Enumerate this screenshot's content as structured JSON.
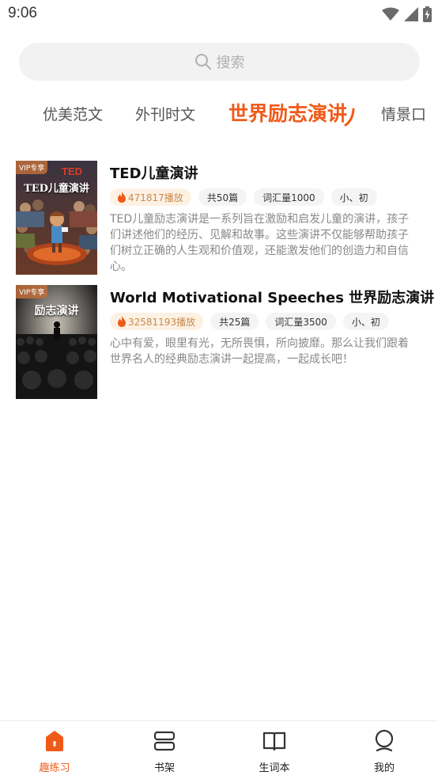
{
  "status_bar": {
    "time": "9:06"
  },
  "search": {
    "placeholder": "搜索"
  },
  "tabs": [
    {
      "label": "优美范文",
      "active": false
    },
    {
      "label": "外刊时文",
      "active": false
    },
    {
      "label": "世界励志演讲",
      "active": true
    },
    {
      "label": "情景口",
      "active": false
    }
  ],
  "books": [
    {
      "vip_label": "VIP专享",
      "cover_title": "TED儿童演讲",
      "title": "TED儿童演讲",
      "plays": "471817播放",
      "count": "共50篇",
      "vocab": "词汇量1000",
      "level": "小、初",
      "description": "TED儿童励志演讲是一系列旨在激励和启发儿童的演讲，孩子们讲述他们的经历、见解和故事。这些演讲不仅能够帮助孩子们树立正确的人生观和价值观，还能激发他们的创造力和自信心。"
    },
    {
      "vip_label": "VIP专享",
      "cover_title": "励志演讲",
      "title": "World Motivational Speeches 世界励志演讲",
      "plays": "32581193播放",
      "count": "共25篇",
      "vocab": "词汇量3500",
      "level": "小、初",
      "description": "心中有爱，眼里有光，无所畏惧，所向披靡。那么让我们跟着世界名人的经典励志演讲一起提高，一起成长吧！"
    }
  ],
  "bottom_nav": [
    {
      "label": "趣练习",
      "icon": "practice-icon",
      "active": true
    },
    {
      "label": "书架",
      "icon": "bookshelf-icon",
      "active": false
    },
    {
      "label": "生词本",
      "icon": "open-book-icon",
      "active": false
    },
    {
      "label": "我的",
      "icon": "profile-icon",
      "active": false
    }
  ],
  "colors": {
    "accent": "#f05a19",
    "chip_hot_bg": "#fdf1e4",
    "chip_bg": "#f4f4f4"
  }
}
